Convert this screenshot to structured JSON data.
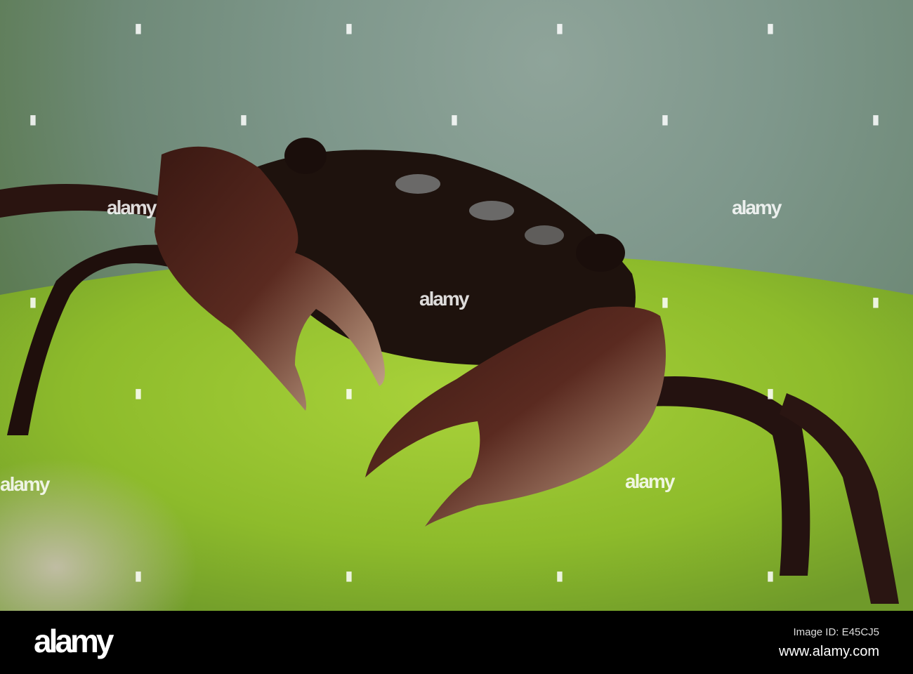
{
  "watermark": {
    "text": "alamy"
  },
  "footer": {
    "logo": "alamy",
    "image_id": "Image ID: E45CJ5",
    "website": "www.alamy.com"
  }
}
